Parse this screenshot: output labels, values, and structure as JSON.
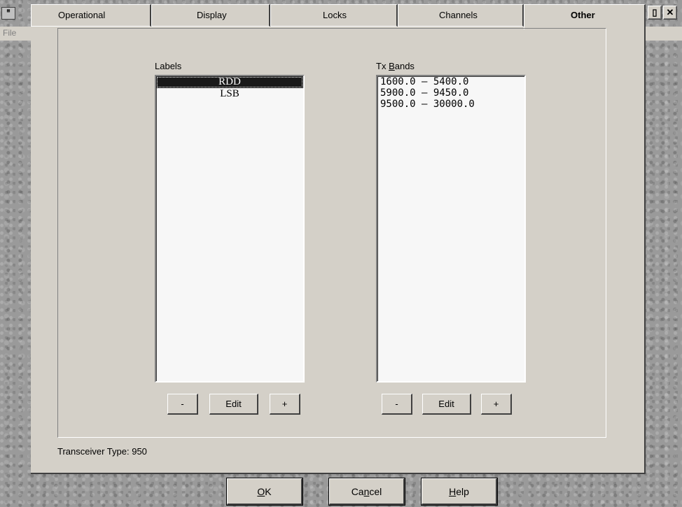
{
  "app": {
    "menu_file": "File"
  },
  "tabs": [
    {
      "label": "Operational",
      "key": "O"
    },
    {
      "label": "Display",
      "key": "i"
    },
    {
      "label": "Locks",
      "key": "L"
    },
    {
      "label": "Channels",
      "key": "n"
    },
    {
      "label": "Other",
      "key": "t"
    }
  ],
  "labels_group": {
    "title": "Labels",
    "items": [
      "RDD",
      "LSB"
    ],
    "selected": "RDD",
    "buttons": {
      "minus": "-",
      "edit": "Edit",
      "plus": "+"
    }
  },
  "bands_group": {
    "title_prefix": "Tx ",
    "title_key": "B",
    "title_rest": "ands",
    "items": [
      "1600.0 – 5400.0",
      "5900.0 – 9450.0",
      "9500.0 – 30000.0"
    ],
    "buttons": {
      "minus": "-",
      "edit": "Edit",
      "plus": "+"
    }
  },
  "status": {
    "transceiver_label": "Transceiver Type: 950"
  },
  "footer": {
    "ok": {
      "key": "O",
      "rest": "K"
    },
    "cancel": {
      "pre": "Ca",
      "key": "n",
      "rest": "cel"
    },
    "help": {
      "key": "H",
      "rest": "elp"
    }
  }
}
